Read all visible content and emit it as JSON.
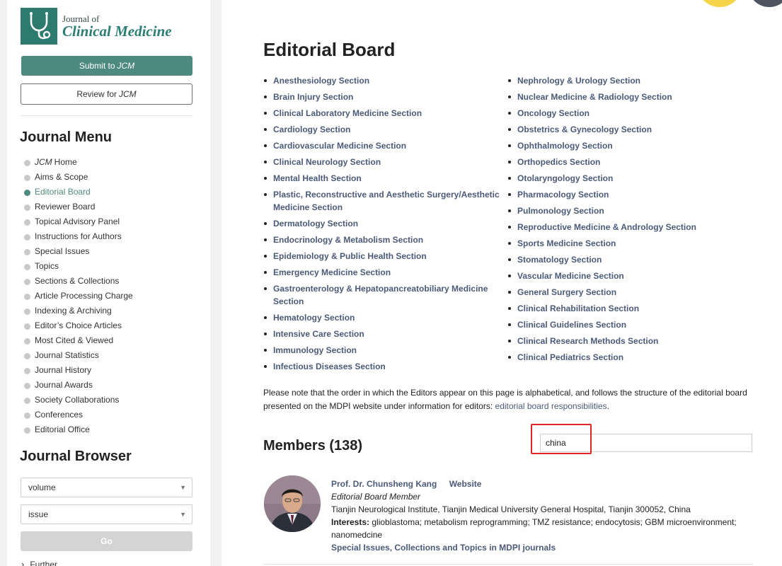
{
  "logo": {
    "line1": "Journal of",
    "line2": "Clinical Medicine"
  },
  "sidebar": {
    "submit_prefix": "Submit to",
    "review_prefix": "Review for",
    "journal_abbr": "JCM",
    "menu_title": "Journal Menu",
    "menu_items": [
      {
        "label": "Home",
        "prefix": "JCM",
        "active": false
      },
      {
        "label": "Aims & Scope",
        "active": false
      },
      {
        "label": "Editorial Board",
        "active": true
      },
      {
        "label": "Reviewer Board",
        "active": false
      },
      {
        "label": "Topical Advisory Panel",
        "active": false
      },
      {
        "label": "Instructions for Authors",
        "active": false
      },
      {
        "label": "Special Issues",
        "active": false
      },
      {
        "label": "Topics",
        "active": false
      },
      {
        "label": "Sections & Collections",
        "active": false
      },
      {
        "label": "Article Processing Charge",
        "active": false
      },
      {
        "label": "Indexing & Archiving",
        "active": false
      },
      {
        "label": "Editor’s Choice Articles",
        "active": false
      },
      {
        "label": "Most Cited & Viewed",
        "active": false
      },
      {
        "label": "Journal Statistics",
        "active": false
      },
      {
        "label": "Journal History",
        "active": false
      },
      {
        "label": "Journal Awards",
        "active": false
      },
      {
        "label": "Society Collaborations",
        "active": false
      },
      {
        "label": "Conferences",
        "active": false
      },
      {
        "label": "Editorial Office",
        "active": false
      }
    ],
    "browser_title": "Journal Browser",
    "volume_select": "volume",
    "issue_select": "issue",
    "go_label": "Go",
    "cut_item": "Further....."
  },
  "main": {
    "title": "Editorial Board",
    "sections_left": [
      "Anesthesiology Section",
      "Brain Injury Section",
      "Clinical Laboratory Medicine Section",
      "Cardiology Section",
      "Cardiovascular Medicine Section",
      "Clinical Neurology Section",
      "Mental Health Section",
      "Plastic, Reconstructive and Aesthetic Surgery/Aesthetic Medicine Section",
      "Dermatology Section",
      "Endocrinology & Metabolism Section",
      "Epidemiology & Public Health Section",
      "Emergency Medicine Section",
      "Gastroenterology & Hepatopancreatobiliary Medicine Section",
      "Hematology Section",
      "Intensive Care Section",
      "Immunology Section",
      "Infectious Diseases Section"
    ],
    "sections_right": [
      "Nephrology & Urology Section",
      "Nuclear Medicine & Radiology Section",
      "Oncology Section",
      "Obstetrics & Gynecology Section",
      "Ophthalmology Section",
      "Orthopedics Section",
      "Otolaryngology Section",
      "Pharmacology Section",
      "Pulmonology Section",
      "Reproductive Medicine & Andrology Section",
      "Sports Medicine Section",
      "Stomatology Section",
      "Vascular Medicine Section",
      "General Surgery Section",
      "Clinical Rehabilitation Section",
      "Clinical Guidelines Section",
      "Clinical Research Methods Section",
      "Clinical Pediatrics Section"
    ],
    "note_text": "Please note that the order in which the Editors appear on this page is alphabetical, and follows the structure of the editorial board presented on the MDPI website under information for editors: ",
    "note_link": "editorial board responsibilities",
    "note_end": ".",
    "members_title": "Members (138)",
    "search_value": "china",
    "member": {
      "name": "Prof. Dr. Chunsheng Kang",
      "website": "Website",
      "role": "Editorial Board Member",
      "affiliation": "Tianjin Neurological Institute, Tianjin Medical University General Hospital, Tianjin 300052, China",
      "interests_label": "Interests:",
      "interests": " glioblastoma; metabolism reprogramming; TMZ resistance; endocytosis; GBM microenvironment; nanomedcine",
      "special_link": "Special Issues, Collections and Topics in MDPI journals"
    }
  },
  "colors": {
    "accent": "#4e8a7f",
    "link": "#4b5a78",
    "highlight": "#e02424"
  }
}
